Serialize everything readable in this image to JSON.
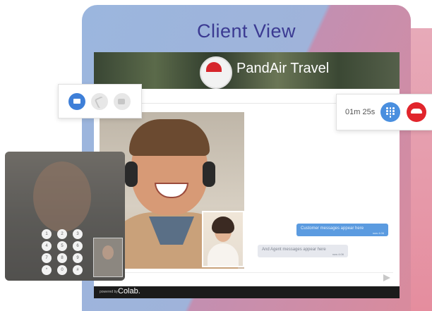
{
  "card": {
    "title": "Client View"
  },
  "app": {
    "brand": "PandAir Travel",
    "chat": {
      "customer_message": "Customer messages appear here",
      "customer_time": "now 4:06",
      "agent_message": "And Agent messages appear here",
      "agent_time": "now 4:06"
    },
    "footer": {
      "powered_by": "powered by",
      "logo": "Colab."
    }
  },
  "controls_left": {
    "icons": [
      "chat-icon",
      "phone-icon",
      "video-icon"
    ]
  },
  "controls_right": {
    "timer": "01m 25s",
    "icons": [
      "keypad-icon",
      "hangup-icon"
    ]
  },
  "mobile_keypad": {
    "keys": [
      "1",
      "2",
      "3",
      "4",
      "5",
      "6",
      "7",
      "8",
      "9",
      "*",
      "0",
      "#"
    ]
  },
  "colors": {
    "title": "#3b3a92",
    "accent_blue": "#3e7fd8",
    "hangup_red": "#e1252c",
    "agent_bubble": "#5b9be0",
    "customer_bubble": "#e6e8ee"
  }
}
